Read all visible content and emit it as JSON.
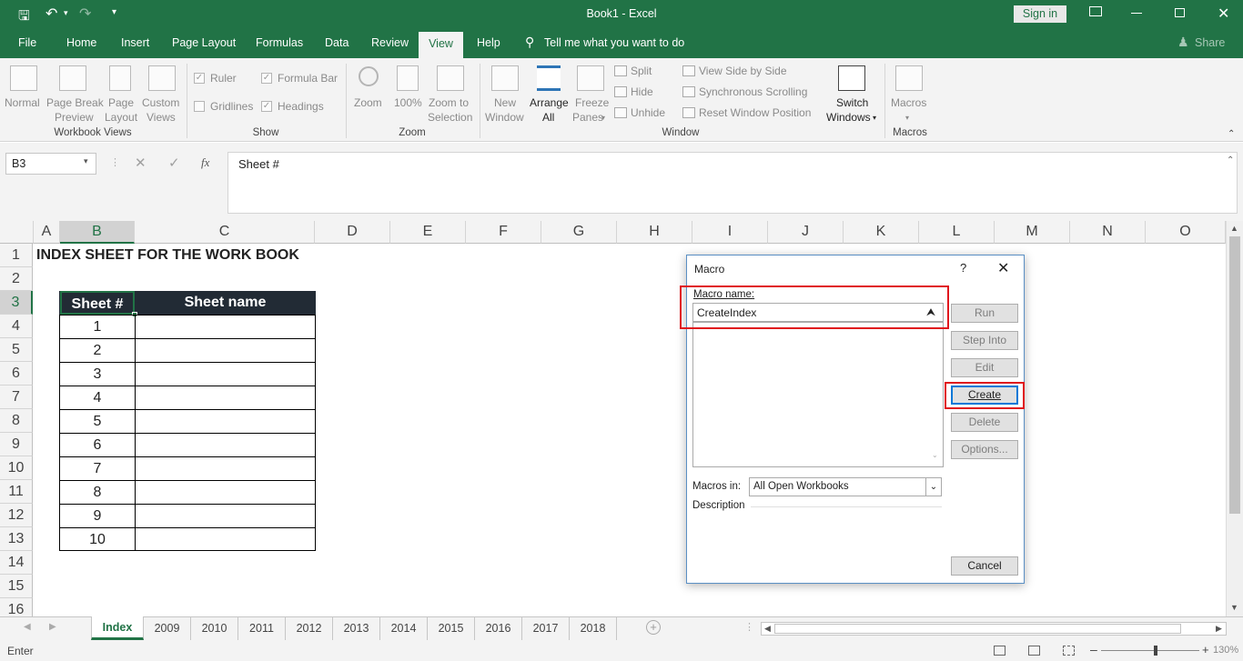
{
  "window": {
    "title": "Book1  -  Excel",
    "sign_in": "Sign in",
    "colors": {
      "brand": "#217346",
      "highlight": "#e0161d"
    }
  },
  "menu": {
    "tabs": [
      "File",
      "Home",
      "Insert",
      "Page Layout",
      "Formulas",
      "Data",
      "Review",
      "View",
      "Help"
    ],
    "active": "View",
    "tell_me": "Tell me what you want to do",
    "share": "Share"
  },
  "ribbon": {
    "workbook_views": {
      "group": "Workbook Views",
      "normal": "Normal",
      "page_break_1": "Page Break",
      "page_break_2": "Preview",
      "page_1": "Page",
      "page_2": "Layout",
      "custom_1": "Custom",
      "custom_2": "Views"
    },
    "show": {
      "group": "Show",
      "ruler": "Ruler",
      "formula_bar": "Formula Bar",
      "gridlines": "Gridlines",
      "headings": "Headings"
    },
    "zoom": {
      "group": "Zoom",
      "zoom": "Zoom",
      "hundred": "100%",
      "sel_1": "Zoom to",
      "sel_2": "Selection"
    },
    "window": {
      "group": "Window",
      "new_1": "New",
      "new_2": "Window",
      "arrange_1": "Arrange",
      "arrange_2": "All",
      "freeze_1": "Freeze",
      "freeze_2": "Panes",
      "split": "Split",
      "hide": "Hide",
      "unhide": "Unhide",
      "side": "View Side by Side",
      "sync": "Synchronous Scrolling",
      "reset": "Reset Window Position",
      "switch_1": "Switch",
      "switch_2": "Windows"
    },
    "macros": {
      "group": "Macros",
      "label": "Macros"
    }
  },
  "formula_bar": {
    "name_box": "B3",
    "fx": "fx",
    "content": "Sheet #"
  },
  "columns": [
    "A",
    "B",
    "C",
    "D",
    "E",
    "F",
    "G",
    "H",
    "I",
    "J",
    "K",
    "L",
    "M",
    "N",
    "O"
  ],
  "rows": [
    "1",
    "2",
    "3",
    "4",
    "5",
    "6",
    "7",
    "8",
    "9",
    "10",
    "11",
    "12",
    "13",
    "14",
    "15",
    "16"
  ],
  "sheet": {
    "title": "INDEX SHEET FOR THE WORK BOOK",
    "header": [
      "Sheet #",
      "Sheet name"
    ],
    "numbers": [
      "1",
      "2",
      "3",
      "4",
      "5",
      "6",
      "7",
      "8",
      "9",
      "10"
    ]
  },
  "dialog": {
    "title": "Macro",
    "help": "?",
    "macro_name_label": "Macro name:",
    "macro_name_value": "CreateIndex",
    "run": "Run",
    "step_into": "Step Into",
    "edit": "Edit",
    "create": "Create",
    "delete": "Delete",
    "options": "Options...",
    "macros_in_label": "Macros in:",
    "macros_in_value": "All Open Workbooks",
    "description": "Description",
    "cancel": "Cancel"
  },
  "sheet_tabs": [
    "Index",
    "2009",
    "2010",
    "2011",
    "2012",
    "2013",
    "2014",
    "2015",
    "2016",
    "2017",
    "2018"
  ],
  "status": {
    "mode": "Enter",
    "zoom": "130%"
  }
}
